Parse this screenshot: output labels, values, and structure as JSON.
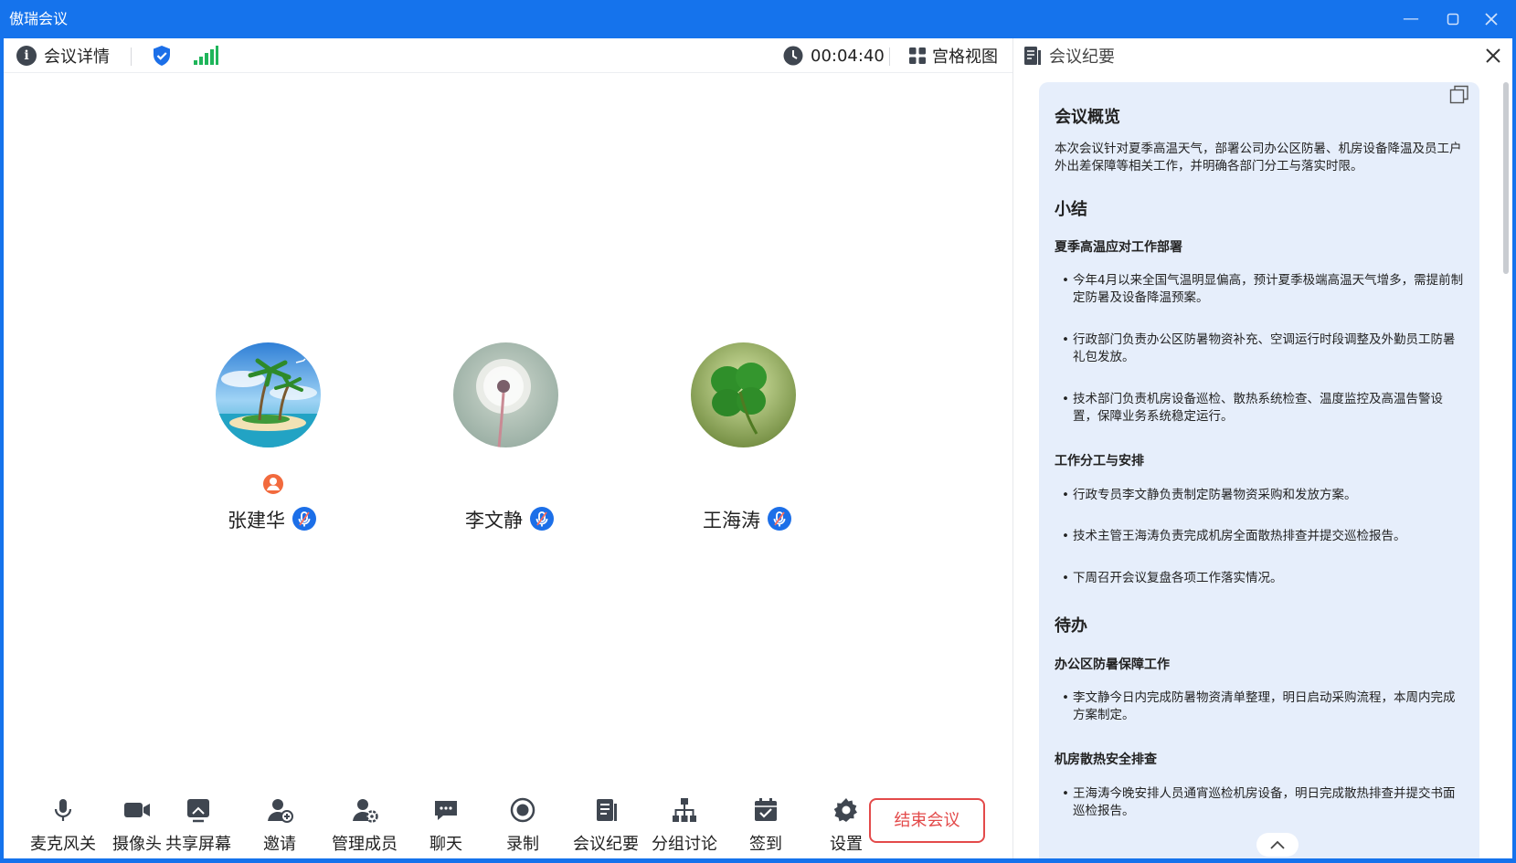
{
  "window": {
    "title": "傲瑞会议"
  },
  "topbar": {
    "details_label": "会议详情",
    "timer": "00:04:40",
    "grid_view_label": "宫格视图"
  },
  "participants": [
    {
      "name": "张建华",
      "role": "host"
    },
    {
      "name": "李文静"
    },
    {
      "name": "王海涛"
    }
  ],
  "toolbar": {
    "mic": "麦克风关",
    "camera": "摄像头",
    "share": "共享屏幕",
    "invite": "邀请",
    "manage": "管理成员",
    "chat": "聊天",
    "record": "录制",
    "minutes": "会议纪要",
    "breakout": "分组讨论",
    "checkin": "签到",
    "settings": "设置",
    "end": "结束会议"
  },
  "panel": {
    "title": "会议纪要",
    "overview_title": "会议概览",
    "overview_text": "本次会议针对夏季高温天气，部署公司办公区防暑、机房设备降温及员工户外出差保障等相关工作，并明确各部门分工与落实时限。",
    "summary_title": "小结",
    "sections": [
      {
        "title": "夏季高温应对工作部署",
        "bullets": [
          "今年4月以来全国气温明显偏高，预计夏季极端高温天气增多，需提前制定防暑及设备降温预案。",
          "行政部门负责办公区防暑物资补充、空调运行时段调整及外勤员工防暑礼包发放。",
          "技术部门负责机房设备巡检、散热系统检查、温度监控及高温告警设置，保障业务系统稳定运行。"
        ]
      },
      {
        "title": "工作分工与安排",
        "bullets": [
          "行政专员李文静负责制定防暑物资采购和发放方案。",
          "技术主管王海涛负责完成机房全面散热排查并提交巡检报告。",
          "下周召开会议复盘各项工作落实情况。"
        ]
      }
    ],
    "todo_title": "待办",
    "todos": [
      {
        "title": "办公区防暑保障工作",
        "bullets": [
          "李文静今日内完成防暑物资清单整理，明日启动采购流程，本周内完成方案制定。"
        ]
      },
      {
        "title": "机房散热安全排查",
        "bullets": [
          "王海涛今晚安排人员通宵巡检机房设备，明日完成散热排查并提交书面巡检报告。"
        ]
      }
    ]
  },
  "colors": {
    "brand": "#1573ec",
    "end_button": "#e34a4a",
    "mic_badge": "#1c6fe8",
    "host_badge": "#f26a3d",
    "signal": "#1fb55a",
    "panel_card": "#e6eefb"
  }
}
